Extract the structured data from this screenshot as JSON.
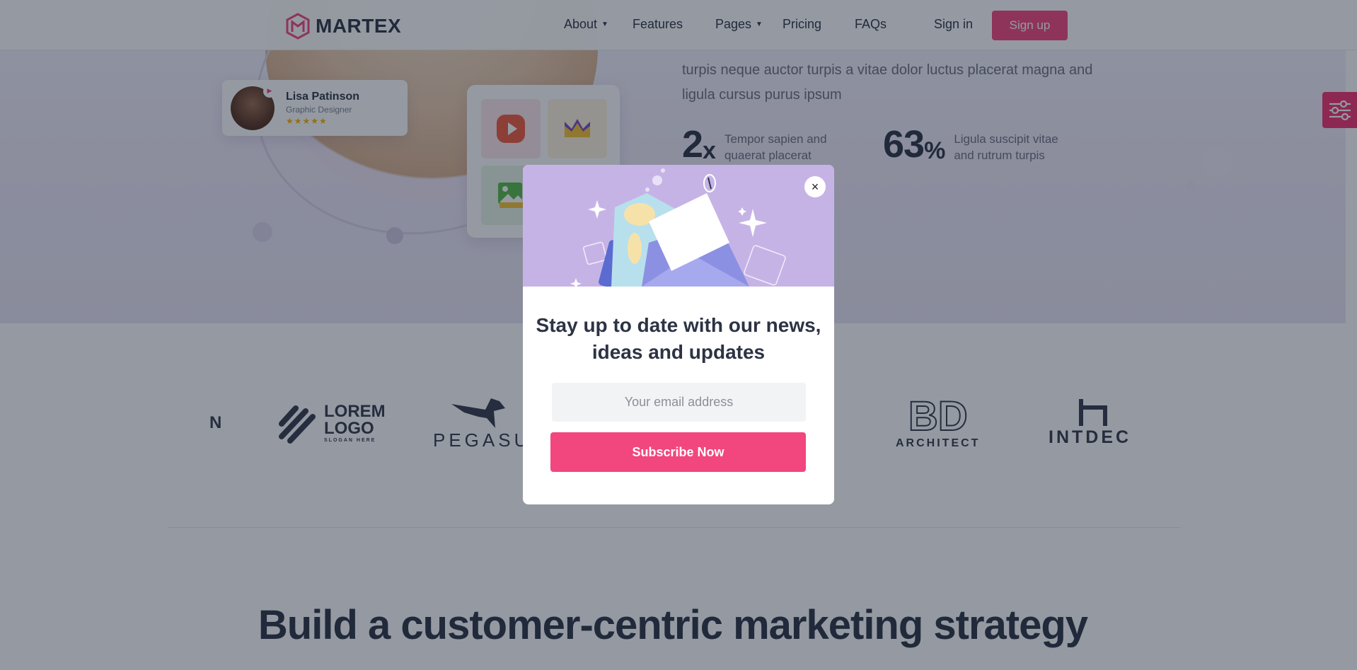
{
  "header": {
    "brand": "MARTEX",
    "nav": [
      {
        "label": "About",
        "has_dropdown": true
      },
      {
        "label": "Features",
        "has_dropdown": false
      },
      {
        "label": "Pages",
        "has_dropdown": true
      },
      {
        "label": "Pricing",
        "has_dropdown": false
      },
      {
        "label": "FAQs",
        "has_dropdown": false
      }
    ],
    "signin": "Sign in",
    "signup": "Sign up"
  },
  "hero": {
    "profile": {
      "name": "Lisa Patinson",
      "role": "Graphic Designer",
      "rating": "★★★★★"
    },
    "text": "turpis neque auctor turpis a vitae dolor luctus placerat magna and ligula cursus purus ipsum",
    "stats": [
      {
        "value": "2",
        "unit": "x",
        "label": "Tempor sapien and quaerat placerat"
      },
      {
        "value": "63",
        "unit": "%",
        "label": "Ligula suscipit vitae and rutrum turpis"
      }
    ]
  },
  "logos": {
    "items": [
      {
        "line1": "LOREM",
        "line2": "LOGO",
        "line3": "SLOGAN HERE"
      },
      {
        "name": "PEGASUS"
      },
      {
        "mark": "BD",
        "name": "ARCHITECT"
      },
      {
        "name": "INTDECO"
      }
    ]
  },
  "headline": "Build a customer-centric marketing strategy",
  "modal": {
    "title": "Stay up to date with our news, ideas and updates",
    "email_placeholder": "Your email address",
    "subscribe": "Subscribe Now",
    "close": "×"
  },
  "colors": {
    "accent": "#f2467f",
    "settings_tab": "#f0306d",
    "overlay": "rgba(20,30,48,0.45)",
    "banner": "#c6b3e6"
  }
}
